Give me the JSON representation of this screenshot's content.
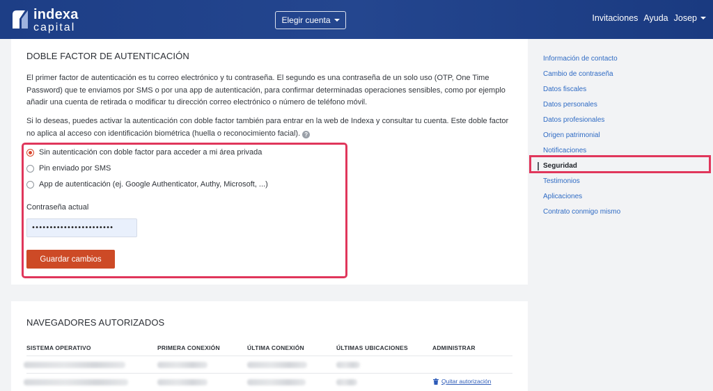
{
  "brand": {
    "name_line1": "indexa",
    "name_line2": "capital"
  },
  "header": {
    "account_button": "Elegir cuenta",
    "nav": [
      "Invitaciones",
      "Ayuda",
      "Josep"
    ]
  },
  "security": {
    "title": "DOBLE FACTOR DE AUTENTICACIÓN",
    "paragraph1": "El primer factor de autenticación es tu correo electrónico y tu contraseña. El segundo es una contraseña de un solo uso (OTP, One Time Password) que te enviamos por SMS o por una app de autenticación, para confirmar determinadas operaciones sensibles, como por ejemplo añadir una cuenta de retirada o modificar tu dirección correo electrónico o número de teléfono móvil.",
    "paragraph2": "Si lo deseas, puedes activar la autenticación con doble factor también para entrar en la web de Indexa y consultar tu cuenta. Este doble factor no aplica al acceso con identificación biométrica (huella o reconocimiento facial).",
    "help_icon": "?",
    "options": [
      {
        "label": "Sin autenticación con doble factor para acceder a mi área privada",
        "checked": true
      },
      {
        "label": "Pin enviado por SMS",
        "checked": false
      },
      {
        "label": "App de autenticación (ej. Google Authenticator, Authy, Microsoft, ...)",
        "checked": false
      }
    ],
    "password_label": "Contraseña actual",
    "password_value": "•••••••••••••••••••••••",
    "save_button": "Guardar cambios"
  },
  "browsers": {
    "title": "NAVEGADORES AUTORIZADOS",
    "columns": [
      "SISTEMA OPERATIVO",
      "PRIMERA CONEXIÓN",
      "ÚLTIMA CONEXIÓN",
      "ÚLTIMAS UBICACIONES",
      "ADMINISTRAR"
    ],
    "revoke_label": "Quitar autorización"
  },
  "sidemenu": {
    "items": [
      "Información de contacto",
      "Cambio de contraseña",
      "Datos fiscales",
      "Datos personales",
      "Datos profesionales",
      "Origen patrimonial",
      "Notificaciones",
      "Seguridad",
      "Testimonios",
      "Aplicaciones",
      "Contrato conmigo mismo"
    ],
    "active": "Seguridad"
  },
  "colors": {
    "header_bg": "#1f4089",
    "accent_button": "#cd4a26",
    "link": "#2f6bc4",
    "highlight_frame": "#e0365b"
  },
  "icons": [
    "indexa-logo-icon",
    "caret-down-icon",
    "help-icon",
    "trash-icon"
  ]
}
